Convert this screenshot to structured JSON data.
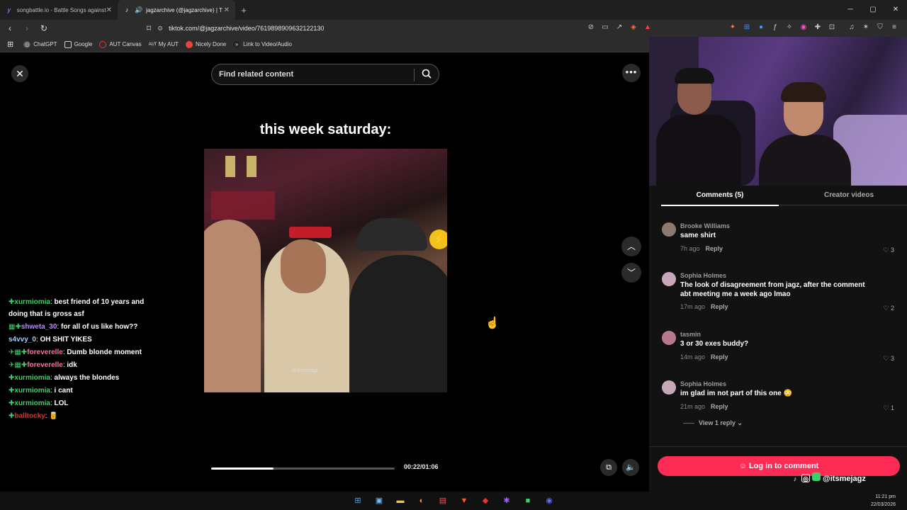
{
  "browser": {
    "tabs": [
      {
        "label": "songbattle.io - Battle Songs against",
        "icon": "songbattle-icon",
        "active": false
      },
      {
        "label": "jagzarchive (@jagzarchive) | T",
        "icon": "tiktok-icon",
        "active": true
      }
    ],
    "new_tab": "+",
    "url": "tiktok.com/@jagzarchive/video/7619898909632122130",
    "bookmarks": [
      {
        "label": "ChatGPT",
        "icon": "chatgpt-icon"
      },
      {
        "label": "Google",
        "icon": "folder-icon"
      },
      {
        "label": "AUT Canvas",
        "icon": "canvas-icon"
      },
      {
        "label": "My AUT",
        "icon": "aut-icon"
      },
      {
        "label": "Nicely Done",
        "icon": "nicelydone-icon"
      },
      {
        "label": "Link to Video/Audio",
        "icon": "link-icon"
      }
    ]
  },
  "video": {
    "search_placeholder": "Find related content",
    "caption": "this week saturday:",
    "watermark": "@itsmejagz",
    "progress": 0.34,
    "time": "00:22/01:06"
  },
  "chat": [
    {
      "user": "xurmiomia",
      "text": "best friend of 10 years and doing that is gross asf",
      "color": "#3fcf6a",
      "badges": "✚"
    },
    {
      "user": "shweta_30",
      "text": "for all of us like how??",
      "color": "#b68cff",
      "badges": "▦✚"
    },
    {
      "user": "s4vvy_0",
      "text": "OH SHIT YIKES",
      "color": "#9ad0ff",
      "badges": ""
    },
    {
      "user": "foreverelle",
      "text": "Dumb blonde moment",
      "color": "#ff6fa5",
      "badges": "✈▦✚"
    },
    {
      "user": "foreverelle",
      "text": "idk",
      "color": "#ff6fa5",
      "badges": "✈▦✚"
    },
    {
      "user": "xurmiomia",
      "text": "always the blondes",
      "color": "#3fcf6a",
      "badges": "✚"
    },
    {
      "user": "xurmiomia",
      "text": "i cant",
      "color": "#3fcf6a",
      "badges": "✚"
    },
    {
      "user": "xurmiomia",
      "text": "LOL",
      "color": "#3fcf6a",
      "badges": "✚"
    },
    {
      "user": "balltocky",
      "text": "🥫",
      "color": "#e03030",
      "badges": "✚"
    }
  ],
  "comments_panel": {
    "tab_comments": "Comments (5)",
    "tab_creator": "Creator videos",
    "comments": [
      {
        "name": "Brooke Williams",
        "text": "same shirt",
        "time": "7h ago",
        "reply": "Reply",
        "likes": "3"
      },
      {
        "name": "Sophia Holmes",
        "text": "The look of disagreement from jagz, after the comment abt meeting me a week ago lmao",
        "time": "17m ago",
        "reply": "Reply",
        "likes": "2"
      },
      {
        "name": "tasmin",
        "text": "3 or 30 exes buddy?",
        "time": "14m ago",
        "reply": "Reply",
        "likes": "3"
      },
      {
        "name": "Sophia Holmes",
        "text": "im glad im not part of this one 😳",
        "time": "21m ago",
        "reply": "Reply",
        "likes": "1"
      }
    ],
    "view_reply": "View 1 reply",
    "login": "Log in to comment"
  },
  "overlay_handle": "@itsmejagz",
  "clock": {
    "time": "11:21 pm",
    "date": "22/03/2026"
  },
  "colors": {
    "tiktok_red": "#fe2c55",
    "chat_green": "#3fcf6a"
  }
}
